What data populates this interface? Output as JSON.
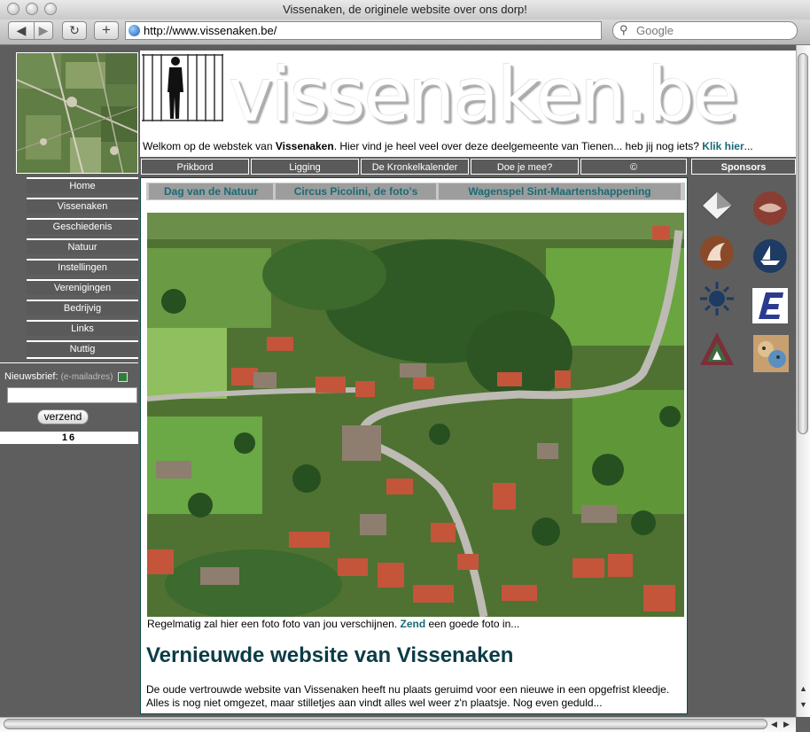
{
  "window": {
    "title": "Vissenaken, de originele website over ons dorp!",
    "url": "http://www.vissenaken.be/",
    "search_placeholder": "Google"
  },
  "header": {
    "logo_text": "vissenaken.be",
    "welcome_prefix": "Welkom op de webstek van ",
    "welcome_bold": "Vissenaken",
    "welcome_middle": ". Hier vind je heel veel over deze deelgemeente van Tienen... heb jij nog iets? ",
    "welcome_link": "Klik hier",
    "welcome_suffix": "..."
  },
  "top_nav": [
    "Prikbord",
    "Ligging",
    "De Kronkelkalender",
    "Doe je mee?",
    "©"
  ],
  "sponsors_label": "Sponsors",
  "side_nav": [
    "Home",
    "Vissenaken",
    "Geschiedenis",
    "Natuur",
    "Instellingen",
    "Verenigingen",
    "Bedrijvig",
    "Links",
    "Nuttig"
  ],
  "newsletter": {
    "label": "Nieuwsbrief:",
    "hint": "(e-mailadres)",
    "submit": "verzend",
    "counter": "16"
  },
  "tabs": [
    "Dag van de Natuur",
    "Circus Picolini, de foto's",
    "Wagenspel Sint-Maartenshappening"
  ],
  "photo": {
    "caption_prefix": "Regelmatig zal hier een foto foto van jou verschijnen. ",
    "caption_link": "Zend",
    "caption_suffix": " een goede foto in..."
  },
  "article": {
    "title": "Vernieuwde website van Vissenaken",
    "line1": "De oude vertrouwde website van Vissenaken heeft nu plaats geruimd voor een nieuwe in een opgefrist kleedje.",
    "line2": "Alles is nog niet omgezet, maar stilletjes aan vindt alles wel weer z'n plaatsje. Nog even geduld..."
  },
  "colors": {
    "accent": "#1a6b74",
    "headline": "#0c3c45",
    "panel_border": "#0c4d4a",
    "nav_bg": "#5a5a5a",
    "page_bg": "#5e5e5e"
  },
  "icons": {
    "sponsor_logos": [
      "pyramid-logo-icon",
      "yin-yang-logo-icon",
      "bird-logo-icon",
      "circle-boat-logo-icon",
      "sunburst-logo-icon",
      "letter-e-logo-icon",
      "triangle-logo-icon",
      "faces-logo-icon"
    ]
  }
}
